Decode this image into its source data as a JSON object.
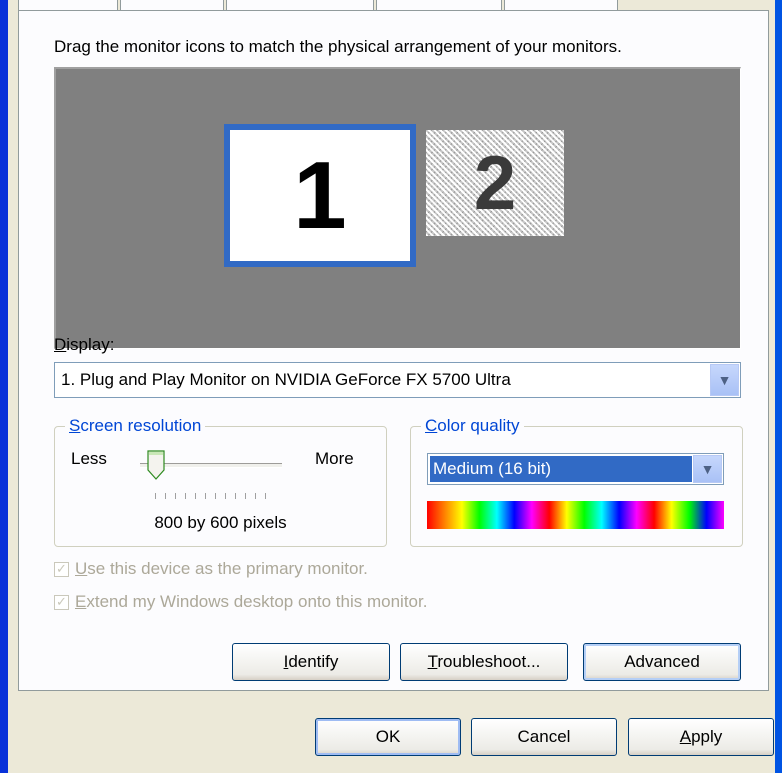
{
  "instruction": "Drag the monitor icons to match the physical arrangement of your monitors.",
  "monitors": [
    {
      "number": "1",
      "selected": true
    },
    {
      "number": "2",
      "selected": false
    }
  ],
  "display": {
    "label": "Display:",
    "value": "1. Plug and Play Monitor on NVIDIA GeForce FX 5700 Ultra"
  },
  "resolution": {
    "title": "Screen resolution",
    "less_label": "Less",
    "more_label": "More",
    "value": "800 by 600 pixels",
    "slider_level_fraction": 0.0
  },
  "color_quality": {
    "title": "Color quality",
    "value": "Medium (16 bit)"
  },
  "checkboxes": {
    "primary": {
      "label": "Use this device as the primary monitor.",
      "checked": true,
      "enabled": false
    },
    "extend": {
      "label": "Extend my Windows desktop onto this monitor.",
      "checked": true,
      "enabled": false
    }
  },
  "panel_buttons": {
    "identify": "Identify",
    "troubleshoot": "Troubleshoot...",
    "advanced": "Advanced"
  },
  "dialog_buttons": {
    "ok": "OK",
    "cancel": "Cancel",
    "apply": "Apply"
  },
  "colors": {
    "selection_blue": "#316ac5",
    "xp_frame_blue": "#0054e3",
    "dialog_bg": "#ece9d8",
    "monitor_area_bg": "#808080",
    "group_title": "#0046d5"
  }
}
